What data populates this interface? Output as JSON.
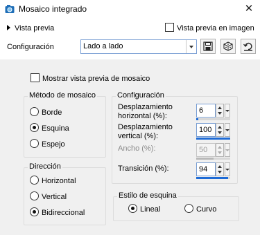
{
  "window": {
    "title": "Mosaico integrado",
    "close_glyph": "✕",
    "app_icon": "camera-app-icon"
  },
  "preview": {
    "label": "Vista previa",
    "image_preview_label": "Vista previa en imagen",
    "image_preview_checked": false
  },
  "config_row": {
    "label": "Configuración",
    "preset_value": "Lado a lado",
    "buttons": [
      "save-preset-icon",
      "randomize-icon",
      "reset-icon"
    ]
  },
  "mosaic_preview": {
    "label": "Mostrar vista previa de mosaico",
    "checked": false
  },
  "method": {
    "title": "Método de mosaico",
    "options": [
      {
        "label": "Borde",
        "selected": false
      },
      {
        "label": "Esquina",
        "selected": true
      },
      {
        "label": "Espejo",
        "selected": false
      }
    ]
  },
  "direction": {
    "title": "Dirección",
    "options": [
      {
        "label": "Horizontal",
        "selected": false
      },
      {
        "label": "Vertical",
        "selected": false
      },
      {
        "label": "Bidireccional",
        "selected": true
      }
    ]
  },
  "configuration": {
    "title": "Configuración",
    "fields": [
      {
        "label_line1": "Desplazamiento",
        "label_line2": "horizontal (%):",
        "value": "6",
        "enabled": true,
        "level": 0.06
      },
      {
        "label_line1": "Desplazamiento",
        "label_line2": "vertical (%):",
        "value": "100",
        "enabled": true,
        "level": 1.0
      },
      {
        "label_line1": "Ancho (%):",
        "label_line2": "",
        "value": "50",
        "enabled": false,
        "level": 0.5
      },
      {
        "label_line1": "Transición (%):",
        "label_line2": "",
        "value": "94",
        "enabled": true,
        "level": 0.94
      }
    ]
  },
  "corner_style": {
    "title": "Estilo de esquina",
    "options": [
      {
        "label": "Lineal",
        "selected": true
      },
      {
        "label": "Curvo",
        "selected": false
      }
    ]
  }
}
